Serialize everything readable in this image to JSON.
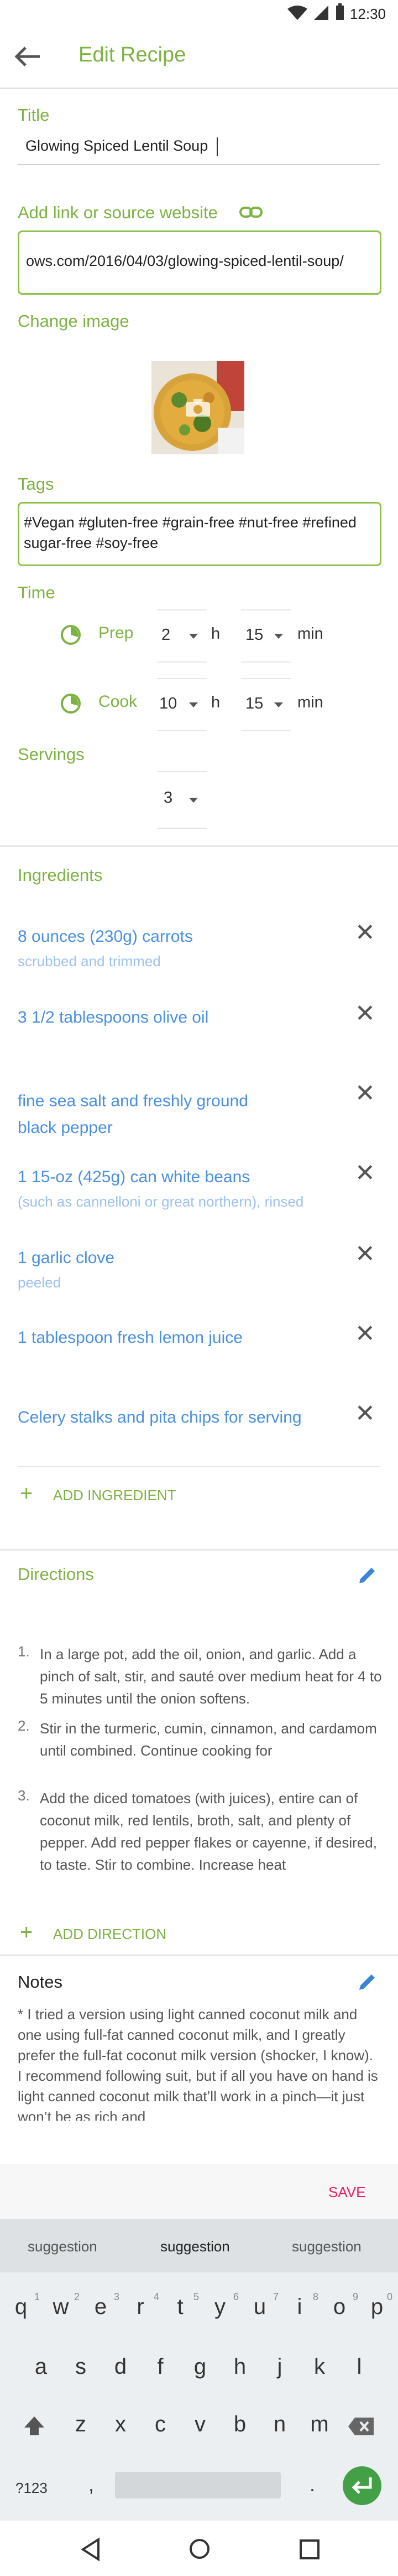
{
  "status": {
    "time": "12:30"
  },
  "appbar": {
    "title": "Edit Recipe"
  },
  "title_section": {
    "label": "Title",
    "value": "Glowing Spiced Lentil Soup"
  },
  "link_section": {
    "label": "Add link or source website",
    "value": "ows.com/2016/04/03/glowing-spiced-lentil-soup/"
  },
  "image_section": {
    "label": "Change image"
  },
  "tags_section": {
    "label": "Tags",
    "value": "#Vegan #gluten-free #grain-free #nut-free #refined sugar-free #soy-free"
  },
  "time_section": {
    "label": "Time",
    "prep": {
      "label": "Prep",
      "hours": "2",
      "h": "h",
      "minutes": "15",
      "min": "min"
    },
    "cook": {
      "label": "Cook",
      "hours": "10",
      "h": "h",
      "minutes": "15",
      "min": "min"
    }
  },
  "servings_section": {
    "label": "Servings",
    "value": "3"
  },
  "ingredients": {
    "header": "Ingredients",
    "items": [
      {
        "name": "8 ounces (230g) carrots",
        "note": "scrubbed and trimmed"
      },
      {
        "name": "3 1/2 tablespoons olive oil",
        "note": ""
      },
      {
        "name": "fine sea salt and freshly ground black pepper",
        "note": ""
      },
      {
        "name": "1 15-oz (425g) can white beans",
        "note": "(such as cannelloni or great northern), rinsed"
      },
      {
        "name": "1 garlic clove",
        "note": "peeled"
      },
      {
        "name": "1 tablespoon fresh lemon juice",
        "note": ""
      },
      {
        "name": "Celery stalks and pita chips for serving",
        "note": ""
      }
    ],
    "add_label": "ADD INGREDIENT"
  },
  "directions": {
    "header": "Directions",
    "steps": [
      {
        "num": "1.",
        "text": "In a large pot, add the oil, onion, and garlic. Add a pinch of salt, stir, and sauté over medium heat for 4 to 5 minutes until the onion softens."
      },
      {
        "num": "2.",
        "text": "Stir in the turmeric, cumin, cinnamon, and cardamom until combined. Continue cooking for"
      },
      {
        "num": "3.",
        "text": "Add the diced tomatoes (with juices), entire can of coconut milk, red lentils, broth, salt, and plenty of pepper. Add red pepper flakes or cayenne, if desired, to taste. Stir to combine. Increase heat"
      }
    ],
    "add_label": "ADD DIRECTION"
  },
  "notes": {
    "header": "Notes",
    "text": "* I tried a version using light canned coconut milk and one using full-fat canned coconut milk, and I greatly prefer the full-fat coconut milk version (shocker, I know). I recommend following suit, but if all you have on hand is light canned coconut milk that’ll work in a pinch—it just won’t be as rich and"
  },
  "save_label": "SAVE",
  "keyboard": {
    "suggestions": [
      "suggestion",
      "suggestion",
      "suggestion"
    ],
    "row1": [
      "q",
      "w",
      "e",
      "r",
      "t",
      "y",
      "u",
      "i",
      "o",
      "p"
    ],
    "row1_nums": [
      "1",
      "2",
      "3",
      "4",
      "5",
      "6",
      "7",
      "8",
      "9",
      "0"
    ],
    "row2": [
      "a",
      "s",
      "d",
      "f",
      "g",
      "h",
      "j",
      "k",
      "l"
    ],
    "row3": [
      "z",
      "x",
      "c",
      "v",
      "b",
      "n",
      "m"
    ],
    "symbols": "?123",
    "comma": ",",
    "period": "."
  },
  "colors": {
    "accent": "#7cb342",
    "link": "#4a90e2",
    "save": "#e91e63"
  }
}
